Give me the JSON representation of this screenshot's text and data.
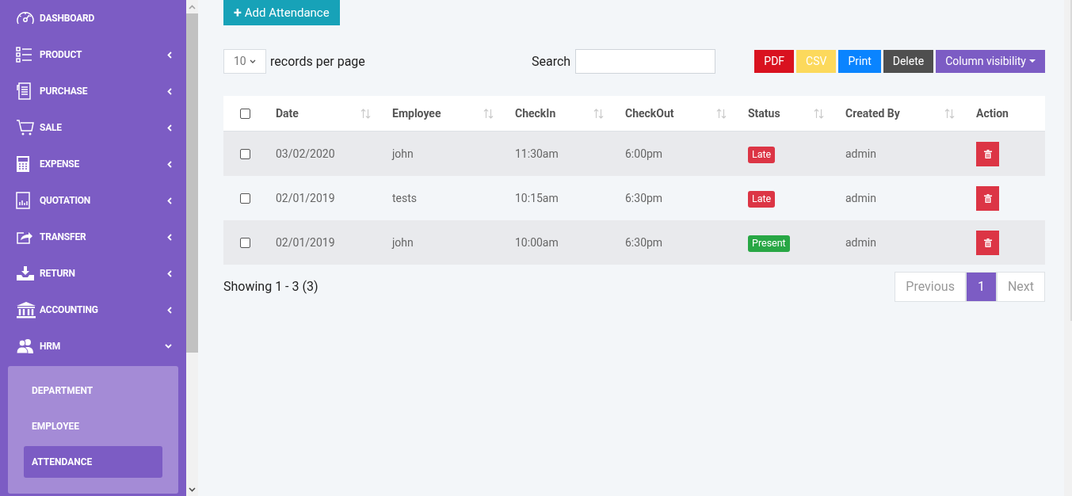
{
  "sidebar": {
    "items": [
      {
        "label": "DASHBOARD"
      },
      {
        "label": "PRODUCT",
        "expanded": false
      },
      {
        "label": "PURCHASE",
        "expanded": false
      },
      {
        "label": "SALE",
        "expanded": false
      },
      {
        "label": "EXPENSE",
        "expanded": false
      },
      {
        "label": "QUOTATION",
        "expanded": false
      },
      {
        "label": "TRANSFER",
        "expanded": false
      },
      {
        "label": "RETURN",
        "expanded": false
      },
      {
        "label": "ACCOUNTING",
        "expanded": false
      },
      {
        "label": "HRM",
        "expanded": true,
        "children": [
          {
            "label": "DEPARTMENT",
            "selected": false
          },
          {
            "label": "EMPLOYEE",
            "selected": false
          },
          {
            "label": "ATTENDANCE",
            "selected": true
          }
        ]
      }
    ]
  },
  "add_button": {
    "icon": "+",
    "label": "Add Attendance"
  },
  "page_length": {
    "value": "10",
    "label": "records per page"
  },
  "search": {
    "label": "Search"
  },
  "export_buttons": [
    {
      "label": "PDF",
      "color": "#d9121f"
    },
    {
      "label": "CSV",
      "color": "#fcd95c"
    },
    {
      "label": "Print",
      "color": "#0a84ff"
    },
    {
      "label": "Delete",
      "color": "#4f4f4f"
    },
    {
      "label": "Column visibility",
      "color": "#7c5cc4"
    }
  ],
  "table": {
    "select_all": {
      "checked": false
    },
    "columns": [
      {
        "label": "Date",
        "sortable": true
      },
      {
        "label": "Employee",
        "sortable": true
      },
      {
        "label": "CheckIn",
        "sortable": true
      },
      {
        "label": "CheckOut",
        "sortable": true
      },
      {
        "label": "Status",
        "sortable": true
      },
      {
        "label": "Created By",
        "sortable": true
      },
      {
        "label": "Action",
        "sortable": false
      }
    ],
    "rows": [
      {
        "checked": false,
        "date": "03/02/2020",
        "employee": "john",
        "checkin": "11:30am",
        "checkout": "6:00pm",
        "status": {
          "label": "Late",
          "color": "#dc3545"
        },
        "created_by": "admin"
      },
      {
        "checked": false,
        "date": "02/01/2019",
        "employee": "tests",
        "checkin": "10:15am",
        "checkout": "6:30pm",
        "status": {
          "label": "Late",
          "color": "#dc3545"
        },
        "created_by": "admin"
      },
      {
        "checked": false,
        "date": "02/01/2019",
        "employee": "john",
        "checkin": "10:00am",
        "checkout": "6:30pm",
        "status": {
          "label": "Present",
          "color": "#28a745"
        },
        "created_by": "admin"
      }
    ]
  },
  "info": "Showing 1 - 3 (3)",
  "pagination": {
    "previous": {
      "label": "Previous",
      "disabled": true
    },
    "pages": [
      {
        "label": "1",
        "selected": true
      }
    ],
    "next": {
      "label": "Next",
      "disabled": true
    }
  }
}
